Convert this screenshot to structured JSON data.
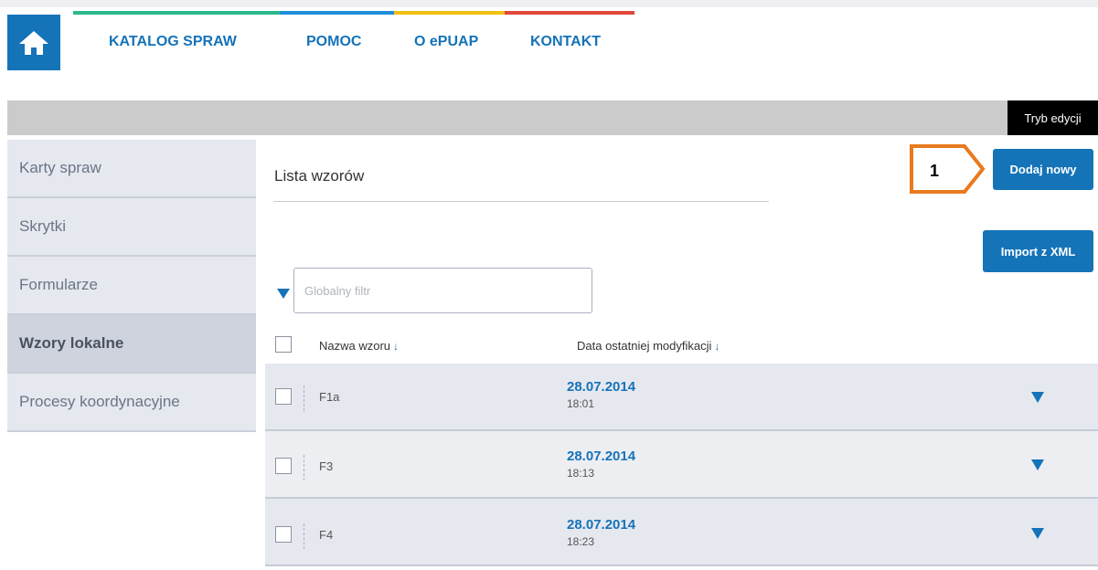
{
  "colors": {
    "primary": "#1573b8",
    "bar_green": "#2ab98c",
    "bar_blue": "#1d8fdb",
    "bar_yellow": "#f3c012",
    "bar_red": "#e2473c",
    "callout_orange": "#e97a1e"
  },
  "header": {
    "home_icon": "home-icon",
    "nav": [
      "KATALOG SPRAW",
      "POMOC",
      "O ePUAP",
      "KONTAKT"
    ]
  },
  "mode_label": "Tryb edycji",
  "sidebar": {
    "items": [
      "Karty spraw",
      "Skrytki",
      "Formularze",
      "Wzory lokalne",
      "Procesy koordynacyjne"
    ],
    "active": "Wzory lokalne"
  },
  "main": {
    "title": "Lista wzorów",
    "callout_number": "1",
    "add_button": "Dodaj nowy",
    "import_button": "Import z XML",
    "filter_placeholder": "Globalny filtr",
    "columns": {
      "name": "Nazwa wzoru",
      "modified": "Data ostatniej modyfikacji",
      "sort_arrow": "↓"
    },
    "rows": [
      {
        "name": "F1a",
        "date": "28.07.2014",
        "time": "18:01"
      },
      {
        "name": "F3",
        "date": "28.07.2014",
        "time": "18:13"
      },
      {
        "name": "F4",
        "date": "28.07.2014",
        "time": "18:23"
      }
    ]
  }
}
